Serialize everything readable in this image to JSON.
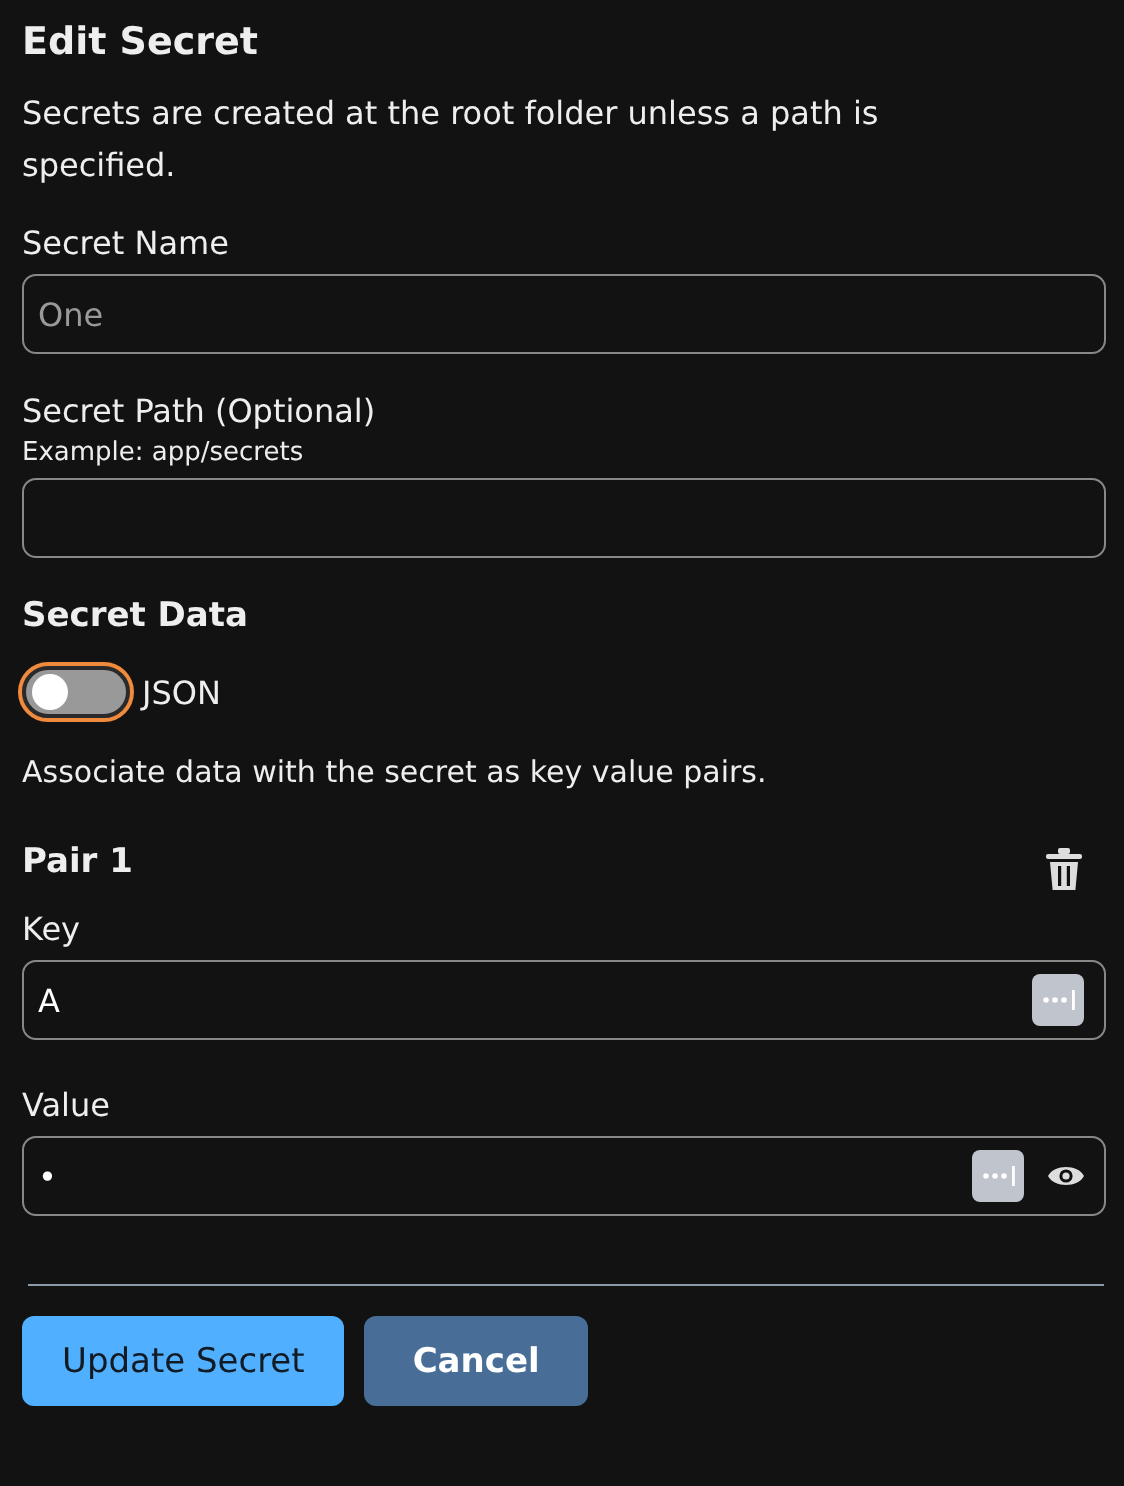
{
  "title": "Edit Secret",
  "intro": "Secrets are created at the root folder unless a path is specified.",
  "name_field": {
    "label": "Secret Name",
    "value": "One",
    "disabled": true
  },
  "path_field": {
    "label": "Secret Path (Optional)",
    "hint": "Example: app/secrets"
  },
  "data_section": {
    "heading": "Secret Data",
    "toggle": {
      "label": "JSON",
      "on": false
    },
    "description": "Associate data with the secret as key value pairs."
  },
  "pairs": [
    {
      "heading": "Pair 1",
      "key_label": "Key",
      "key": "A",
      "value_label": "Value",
      "value": "•"
    }
  ],
  "buttons": [
    {
      "label": "Update Secret",
      "kind": "primary"
    },
    {
      "label": "Cancel",
      "kind": "secondary"
    }
  ]
}
